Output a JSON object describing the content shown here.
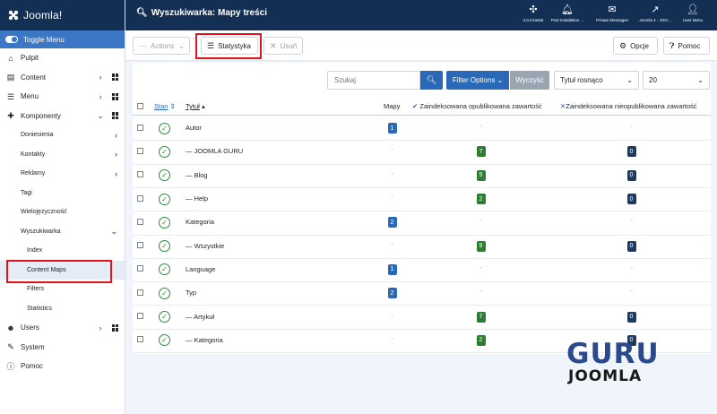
{
  "brand": {
    "name": "Joomla!"
  },
  "sidebar": {
    "toggle_label": "Toggle Menu",
    "items": [
      {
        "label": "Pulpit",
        "icon": "home-icon"
      },
      {
        "label": "Content",
        "icon": "file-icon"
      },
      {
        "label": "Menu",
        "icon": "list-icon"
      },
      {
        "label": "Komponenty",
        "icon": "puzzle-icon"
      }
    ],
    "komponenty_sub": [
      {
        "label": "Doniesienia"
      },
      {
        "label": "Kontakty"
      },
      {
        "label": "Reklamy"
      },
      {
        "label": "Tagi"
      },
      {
        "label": "Wielojęzyczność"
      },
      {
        "label": "Wyszukiwarka"
      }
    ],
    "wyszukiwarka_sub": [
      {
        "label": "Index"
      },
      {
        "label": "Content Maps"
      },
      {
        "label": "Filters"
      },
      {
        "label": "Statistics"
      }
    ],
    "bottom_items": [
      {
        "label": "Users",
        "icon": "users-icon"
      },
      {
        "label": "System",
        "icon": "wrench-icon"
      },
      {
        "label": "Pomoc",
        "icon": "info-icon"
      }
    ]
  },
  "header": {
    "title": "Wyszukiwarka: Mapy treści",
    "buttons": [
      {
        "label": "4.0.0-beta5",
        "icon": "joomla-icon"
      },
      {
        "label": "Post Installation ...",
        "icon": "bell-icon"
      },
      {
        "label": "Private Messages",
        "icon": "envelope-icon"
      },
      {
        "label": "Joomla 4 - JOO...",
        "icon": "external-link-icon"
      },
      {
        "label": "User Menu",
        "icon": "user-icon"
      }
    ]
  },
  "toolbar": {
    "actions_label": "Actions",
    "stats_label": "Statystyka",
    "delete_label": "Usuń",
    "options_label": "Opcje",
    "help_label": "Pomoc"
  },
  "filters": {
    "search_placeholder": "Szukaj",
    "filter_options_label": "Filter Options",
    "clear_label": "Wyczyść",
    "sort_value": "Tytuł rosnąco",
    "limit_value": "20"
  },
  "table": {
    "headers": {
      "status": "Stan",
      "title": "Tytuł",
      "maps": "Mapy",
      "published": "Zaindeksowana opublikowana zawartość",
      "unpublished": "Zaindeksowana nieopublikowana zawartość"
    },
    "rows": [
      {
        "title": "Autor",
        "maps": "1",
        "published": "-",
        "unpublished": "-"
      },
      {
        "title": "— JOOMLA GURU",
        "maps": "-",
        "published": "7",
        "unpublished": "0"
      },
      {
        "title": "— Blog",
        "maps": "-",
        "published": "5",
        "unpublished": "0"
      },
      {
        "title": "— Help",
        "maps": "-",
        "published": "2",
        "unpublished": "0"
      },
      {
        "title": "Kategoria",
        "maps": "2",
        "published": "-",
        "unpublished": "-"
      },
      {
        "title": "— Wszystkie",
        "maps": "-",
        "published": "9",
        "unpublished": "0"
      },
      {
        "title": "Language",
        "maps": "1",
        "published": "-",
        "unpublished": "-"
      },
      {
        "title": "Typ",
        "maps": "2",
        "published": "-",
        "unpublished": "-"
      },
      {
        "title": "— Artykuł",
        "maps": "-",
        "published": "7",
        "unpublished": "0"
      },
      {
        "title": "— Kategoria",
        "maps": "-",
        "published": "2",
        "unpublished": "0"
      }
    ]
  },
  "watermark": {
    "line1": "GURU",
    "line2": "JOOMLA"
  },
  "colors": {
    "header_bg": "#132f53",
    "accent": "#2a69b8",
    "green": "#2e7d32",
    "navy": "#1e3a5f",
    "highlight_box": "#e0151b"
  }
}
